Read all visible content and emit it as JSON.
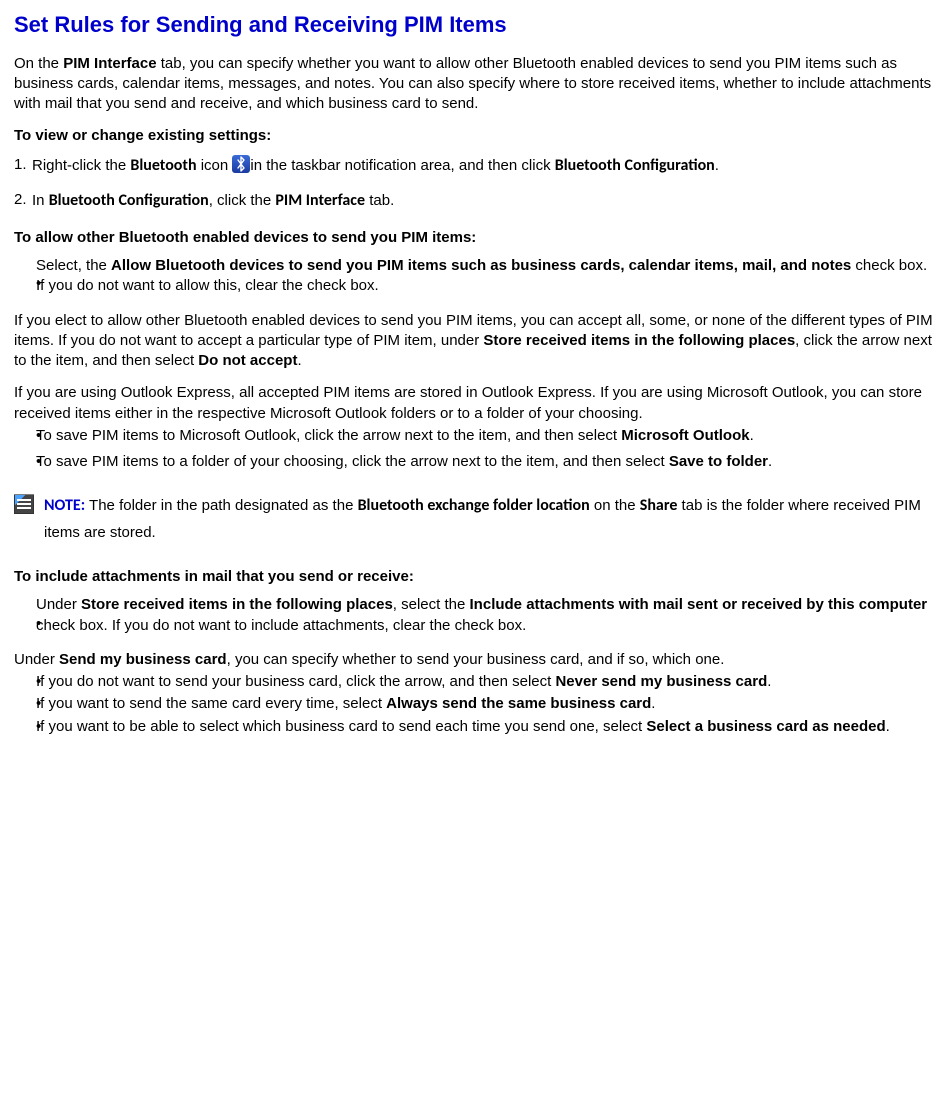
{
  "title": "Set Rules for Sending and Receiving PIM Items",
  "intro": {
    "pre": "On the ",
    "term": "PIM Interface",
    "post": " tab, you can specify whether you want to allow other Bluetooth enabled devices to send you PIM items such as business cards, calendar items, messages, and notes. You can also specify where to store received items, whether to include attachments with mail that you send and receive, and which business card to send."
  },
  "heading_view": "To view or change existing settings:",
  "step1": {
    "num": "1.",
    "a": "Right-click the ",
    "bt": "Bluetooth",
    "b": " icon ",
    "c": "in the taskbar notification area, and then click ",
    "cfg": "Bluetooth Configuration",
    "d": "."
  },
  "step2": {
    "num": "2.",
    "a": "In ",
    "cfg": "Bluetooth Configuration",
    "b": ", click the ",
    "pim": "PIM Interface",
    "c": " tab."
  },
  "heading_allow": "To allow other Bluetooth enabled devices to send you PIM items:",
  "allow_bullet": {
    "a": "Select, the ",
    "bold": "Allow Bluetooth devices to send you PIM items such as business cards, calendar items, mail, and notes",
    "b": " check box. If you do not want to allow this, clear the check box."
  },
  "para_elect": {
    "a": "If you elect to allow other Bluetooth enabled devices to send you PIM items, you can accept all, some, or none of the different types of PIM items. If you do not want to accept a particular type of PIM item, under ",
    "b1": "Store received items in the following places",
    "c": ", click the arrow next to the item, and then select ",
    "b2": "Do not accept",
    "d": "."
  },
  "para_outlook": "If you are using Outlook Express, all accepted PIM items are stored in Outlook Express. If you are using Microsoft Outlook, you can store received items either in the respective Microsoft Outlook folders or to a folder of your choosing.",
  "save_b1": {
    "a": "To save PIM items to Microsoft Outlook, click the arrow next to the item, and then select ",
    "bold": "Microsoft Outlook",
    "b": "."
  },
  "save_b2": {
    "a": "To save PIM items to a folder of your choosing, click the arrow next to the item, and then select ",
    "bold": "Save to folder",
    "b": "."
  },
  "note": {
    "label": "NOTE:",
    "a": " The folder in the path designated as the ",
    "t1": "Bluetooth exchange folder location",
    "b": " on the ",
    "t2": "Share",
    "c": " tab is the folder where received PIM items are stored."
  },
  "heading_attach": "To include attachments in mail that you send or receive:",
  "attach_bullet": {
    "a": "Under ",
    "b1": "Store received items in the following places",
    "b": ", select the ",
    "b2": "Include attachments with mail sent or received by this computer",
    "c": " check box. If you do not want to include attachments, clear the check box."
  },
  "para_sendcard": {
    "a": "Under ",
    "bold": "Send my business card",
    "b": ", you can specify whether to send your business card, and if so, which one."
  },
  "card_b1": {
    "a": "If you do not want to send your business card, click the arrow, and then select ",
    "bold": "Never send my business card",
    "b": "."
  },
  "card_b2": {
    "a": "If you want to send the same card every time, select ",
    "bold": "Always send the same business card",
    "b": "."
  },
  "card_b3": {
    "a": "If you want to be able to select which business card to send each time you send one, select ",
    "bold": "Select a business card as needed",
    "b": "."
  },
  "bullet": "•"
}
